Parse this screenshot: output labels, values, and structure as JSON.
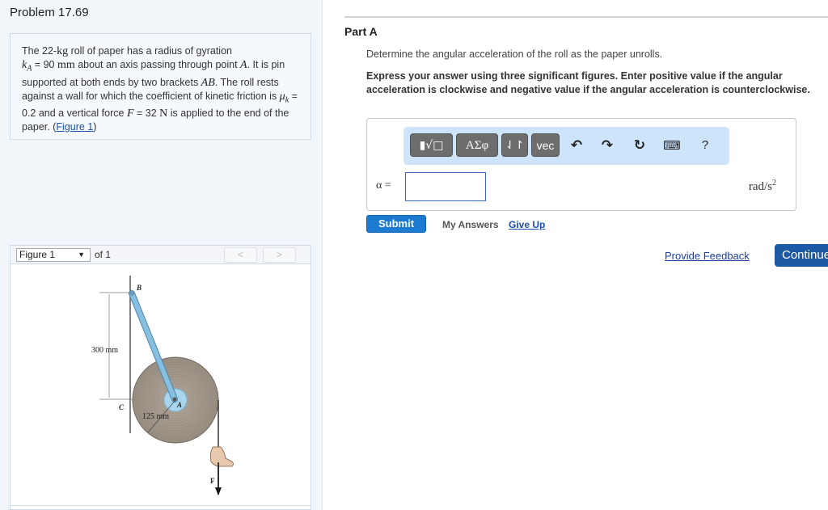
{
  "problem": {
    "title": "Problem 17.69",
    "text": {
      "p1": "The 22-",
      "kg": "kg",
      "p2": " roll of paper has a radius of gyration",
      "kA": "k",
      "kA_sub": "A",
      "p3": " = 90 ",
      "mm": "mm",
      "p4": " about an axis passing through point ",
      "A": "A",
      "p5": ". It is pin supported at both ends by two brackets ",
      "AB": "AB",
      "p6": ". The roll rests against a wall for which the coefficient of kinetic friction is ",
      "mu": "μ",
      "mu_sub": "k",
      "p7": " = 0.2 and a vertical force ",
      "F": "F",
      "p8": " = 32  ",
      "N": "N",
      "p9": " is applied to the end of the paper. (",
      "figure_link": "Figure 1",
      "p10": ")"
    }
  },
  "figure_nav": {
    "selected": "Figure 1",
    "caret": "▼",
    "of_label": "of 1",
    "prev": "<",
    "next": ">"
  },
  "figure": {
    "labels": {
      "B": "B",
      "C": "C",
      "A": "A",
      "F": "F",
      "height": "300 mm",
      "radius": "125 mm"
    },
    "colors": {
      "roll": "#a39a8f",
      "bracket": "#7fb6d8",
      "hub": "#a8d6ee"
    }
  },
  "part": {
    "title": "Part A",
    "question": "Determine the angular acceleration of the roll as the paper unrolls.",
    "instruction": "Express your answer using three significant figures. Enter positive value if the angular acceleration is clockwise and negative value if the angular acceleration is counterclockwise."
  },
  "toolbar": {
    "templates": "▮√□",
    "greek": "ΑΣφ",
    "arrows": "⇃↾",
    "vec": "vec",
    "undo": "↶",
    "redo": "↷",
    "reset": "↻",
    "keyboard": "⌨",
    "help": "?"
  },
  "answer": {
    "label": "α =",
    "value": "",
    "units": "rad/s",
    "units_exp": "2"
  },
  "actions": {
    "submit": "Submit",
    "my_answers": "My Answers",
    "give_up": "Give Up",
    "feedback": "Provide Feedback",
    "continue": "Continue"
  },
  "colors": {
    "submit": "#1c7bd1",
    "continue": "#1d5aa6",
    "toolbar_bg": "#cde4fb",
    "link": "#1a55a5"
  }
}
